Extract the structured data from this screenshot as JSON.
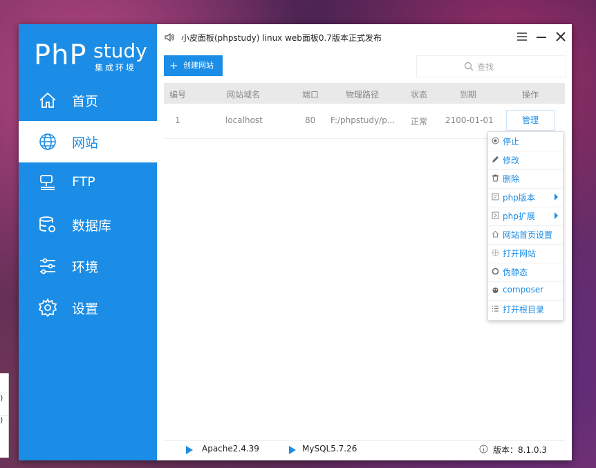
{
  "background_card": {
    "rows": [
      ")",
      ")"
    ]
  },
  "logo": {
    "main": "PhP",
    "sub1": "study",
    "sub2": "集成环境"
  },
  "sidebar": {
    "items": [
      {
        "label": "首页",
        "icon": "home-icon"
      },
      {
        "label": "网站",
        "icon": "globe-icon",
        "active": true
      },
      {
        "label": "FTP",
        "icon": "ftp-icon"
      },
      {
        "label": "数据库",
        "icon": "database-icon"
      },
      {
        "label": "环境",
        "icon": "sliders-icon"
      },
      {
        "label": "设置",
        "icon": "gear-icon"
      }
    ]
  },
  "titlebar": {
    "title": "小皮面板(phpstudy) linux web面板0.7版本正式发布"
  },
  "toolbar": {
    "create_label": "创建网站",
    "search_placeholder": "查找"
  },
  "table": {
    "headers": [
      "编号",
      "网站域名",
      "端口",
      "物理路径",
      "状态",
      "到期",
      "操作"
    ],
    "rows": [
      {
        "id": "1",
        "domain": "localhost",
        "port": "80",
        "path": "F:/phpstudy/p...",
        "status": "正常",
        "expiry": "2100-01-01",
        "action": "管理"
      }
    ]
  },
  "dropdown": {
    "items": [
      {
        "label": "停止",
        "icon": "stop-icon"
      },
      {
        "label": "修改",
        "icon": "pencil-icon"
      },
      {
        "label": "删除",
        "icon": "trash-icon"
      },
      {
        "label": "php版本",
        "icon": "php-version-icon",
        "submenu": true
      },
      {
        "label": "php扩展",
        "icon": "php-extension-icon",
        "submenu": true
      },
      {
        "label": "网站首页设置",
        "icon": "home-small-icon"
      },
      {
        "label": "打开网站",
        "icon": "globe-small-icon"
      },
      {
        "label": "伪静态",
        "icon": "rewrite-icon"
      },
      {
        "label": "composer",
        "icon": "composer-icon"
      },
      {
        "label": "打开根目录",
        "icon": "list-icon"
      }
    ]
  },
  "statusbar": {
    "apache": "Apache2.4.39",
    "mysql": "MySQL5.7.26",
    "version": "版本：8.1.0.3"
  },
  "colors": {
    "accent": "#1b8de6",
    "header_bg": "#e9e9e9"
  }
}
